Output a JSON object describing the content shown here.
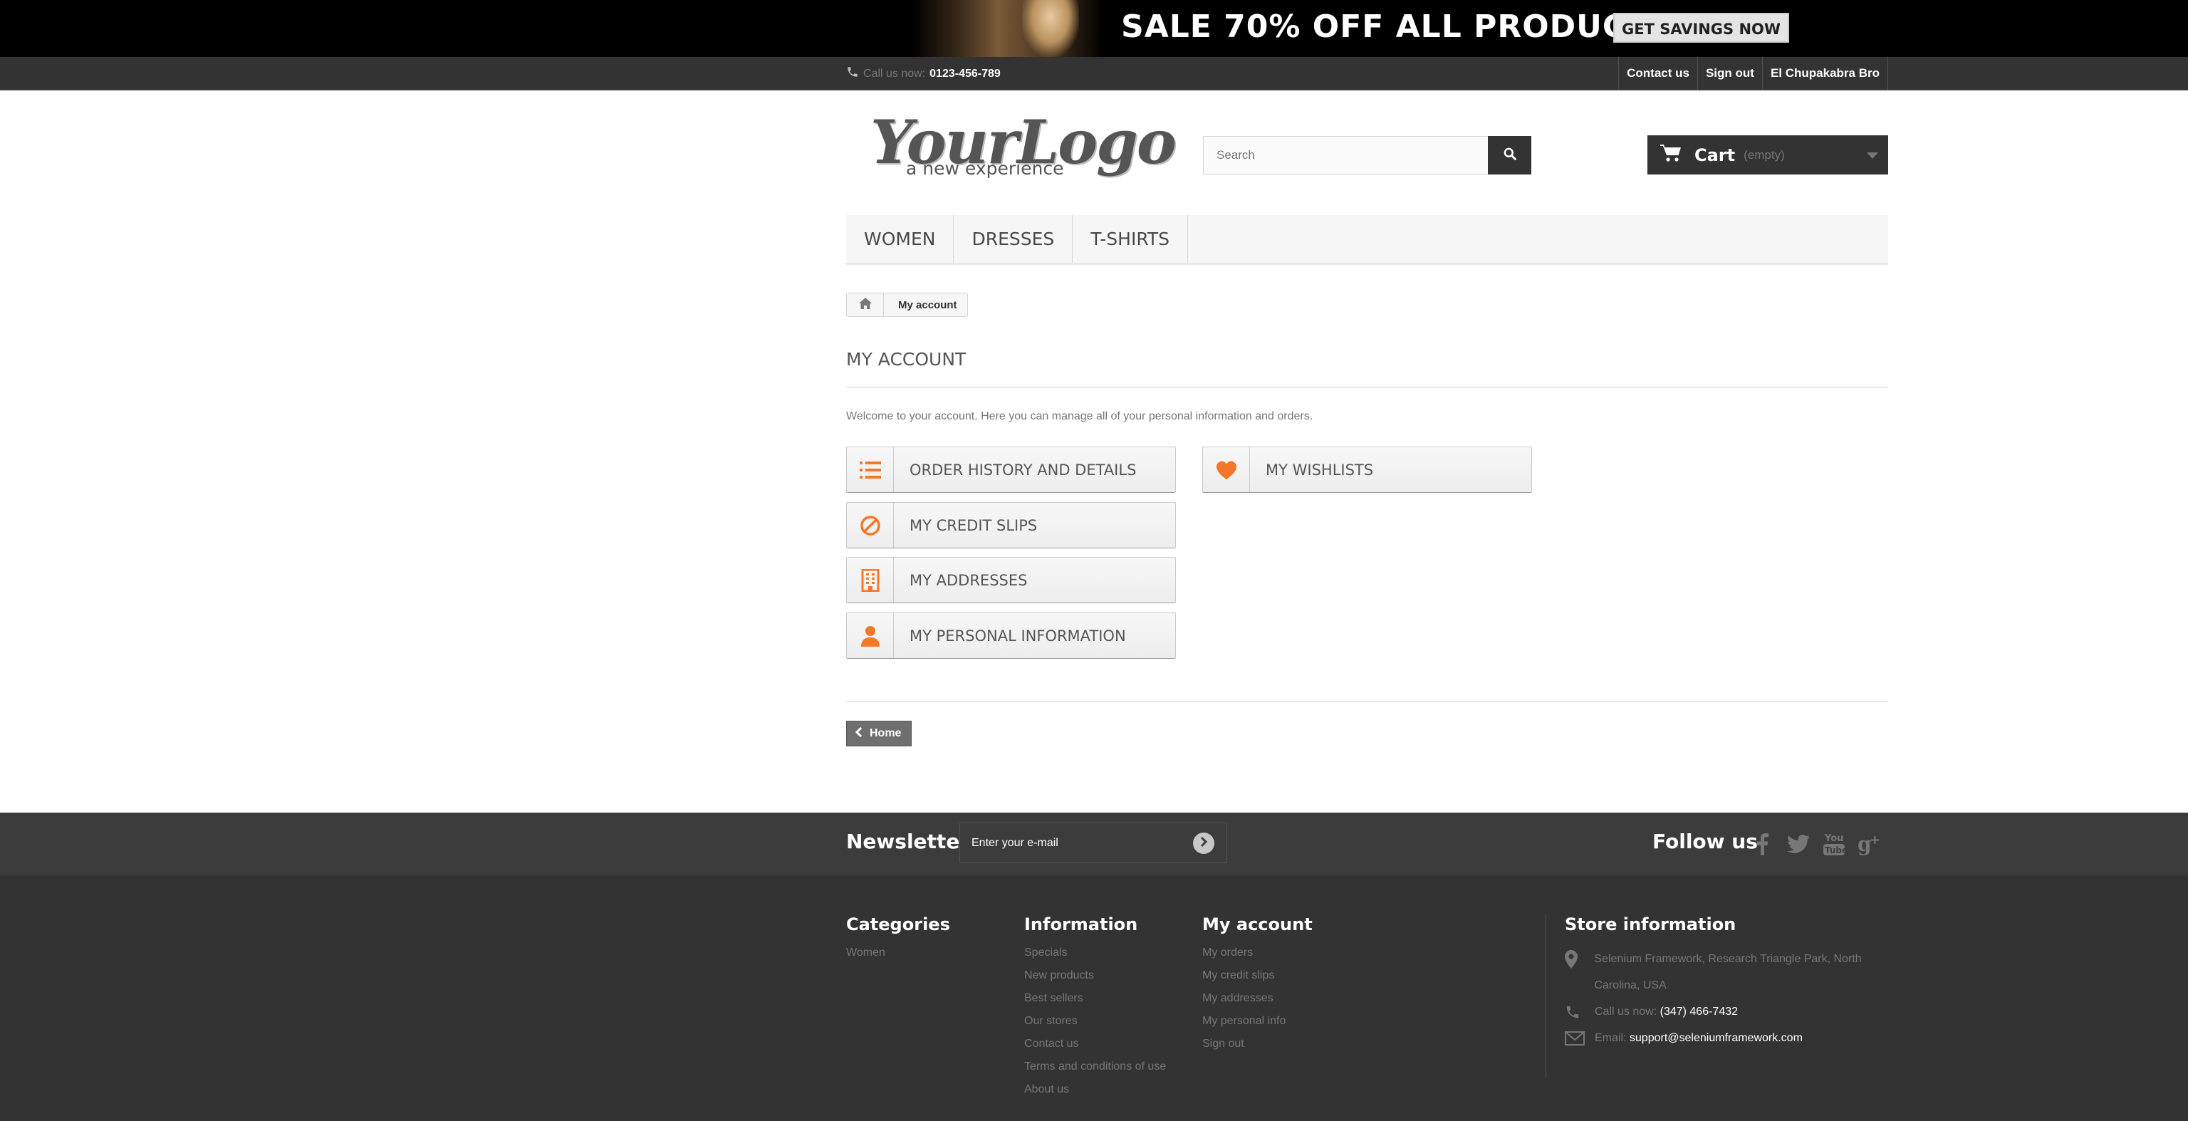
{
  "banner": {
    "headline": "SALE 70% OFF ALL PRODUCTS",
    "cta": "GET SAVINGS NOW"
  },
  "topnav": {
    "call_label": "Call us now:",
    "phone": "0123-456-789",
    "links": [
      "Contact us",
      "Sign out",
      "El Chupakabra Bro"
    ]
  },
  "logo": {
    "main": "YourLogo",
    "tagline": "a new experience"
  },
  "search": {
    "placeholder": "Search"
  },
  "cart": {
    "label": "Cart",
    "status": "(empty)"
  },
  "menu": [
    "Women",
    "Dresses",
    "T-shirts"
  ],
  "breadcrumb": {
    "current": "My account"
  },
  "page": {
    "title": "My account",
    "welcome": "Welcome to your account. Here you can manage all of your personal information and orders."
  },
  "account_links": {
    "order_history": "Order history and details",
    "credit_slips": "My credit slips",
    "addresses": "My addresses",
    "personal_info": "My personal information",
    "wishlists": "My wishlists"
  },
  "home_button": "Home",
  "footer": {
    "newsletter": {
      "title": "Newsletter",
      "placeholder": "Enter your e-mail"
    },
    "follow": "Follow us",
    "social_icons": [
      "facebook-icon",
      "twitter-icon",
      "youtube-icon",
      "google-plus-icon"
    ],
    "categories": {
      "title": "Categories",
      "items": [
        "Women"
      ]
    },
    "information": {
      "title": "Information",
      "items": [
        "Specials",
        "New products",
        "Best sellers",
        "Our stores",
        "Contact us",
        "Terms and conditions of use",
        "About us"
      ]
    },
    "my_account": {
      "title": "My account",
      "items": [
        "My orders",
        "My credit slips",
        "My addresses",
        "My personal info",
        "Sign out"
      ]
    },
    "store": {
      "title": "Store information",
      "address": "Selenium Framework, Research Triangle Park, North Carolina, USA",
      "call_label": "Call us now:",
      "phone": "(347) 466-7432",
      "email_label": "Email:",
      "email": "support@seleniumframework.com"
    }
  },
  "colors": {
    "accent": "#f13340",
    "icon_orange": "#f5782a",
    "dark": "#333333"
  }
}
